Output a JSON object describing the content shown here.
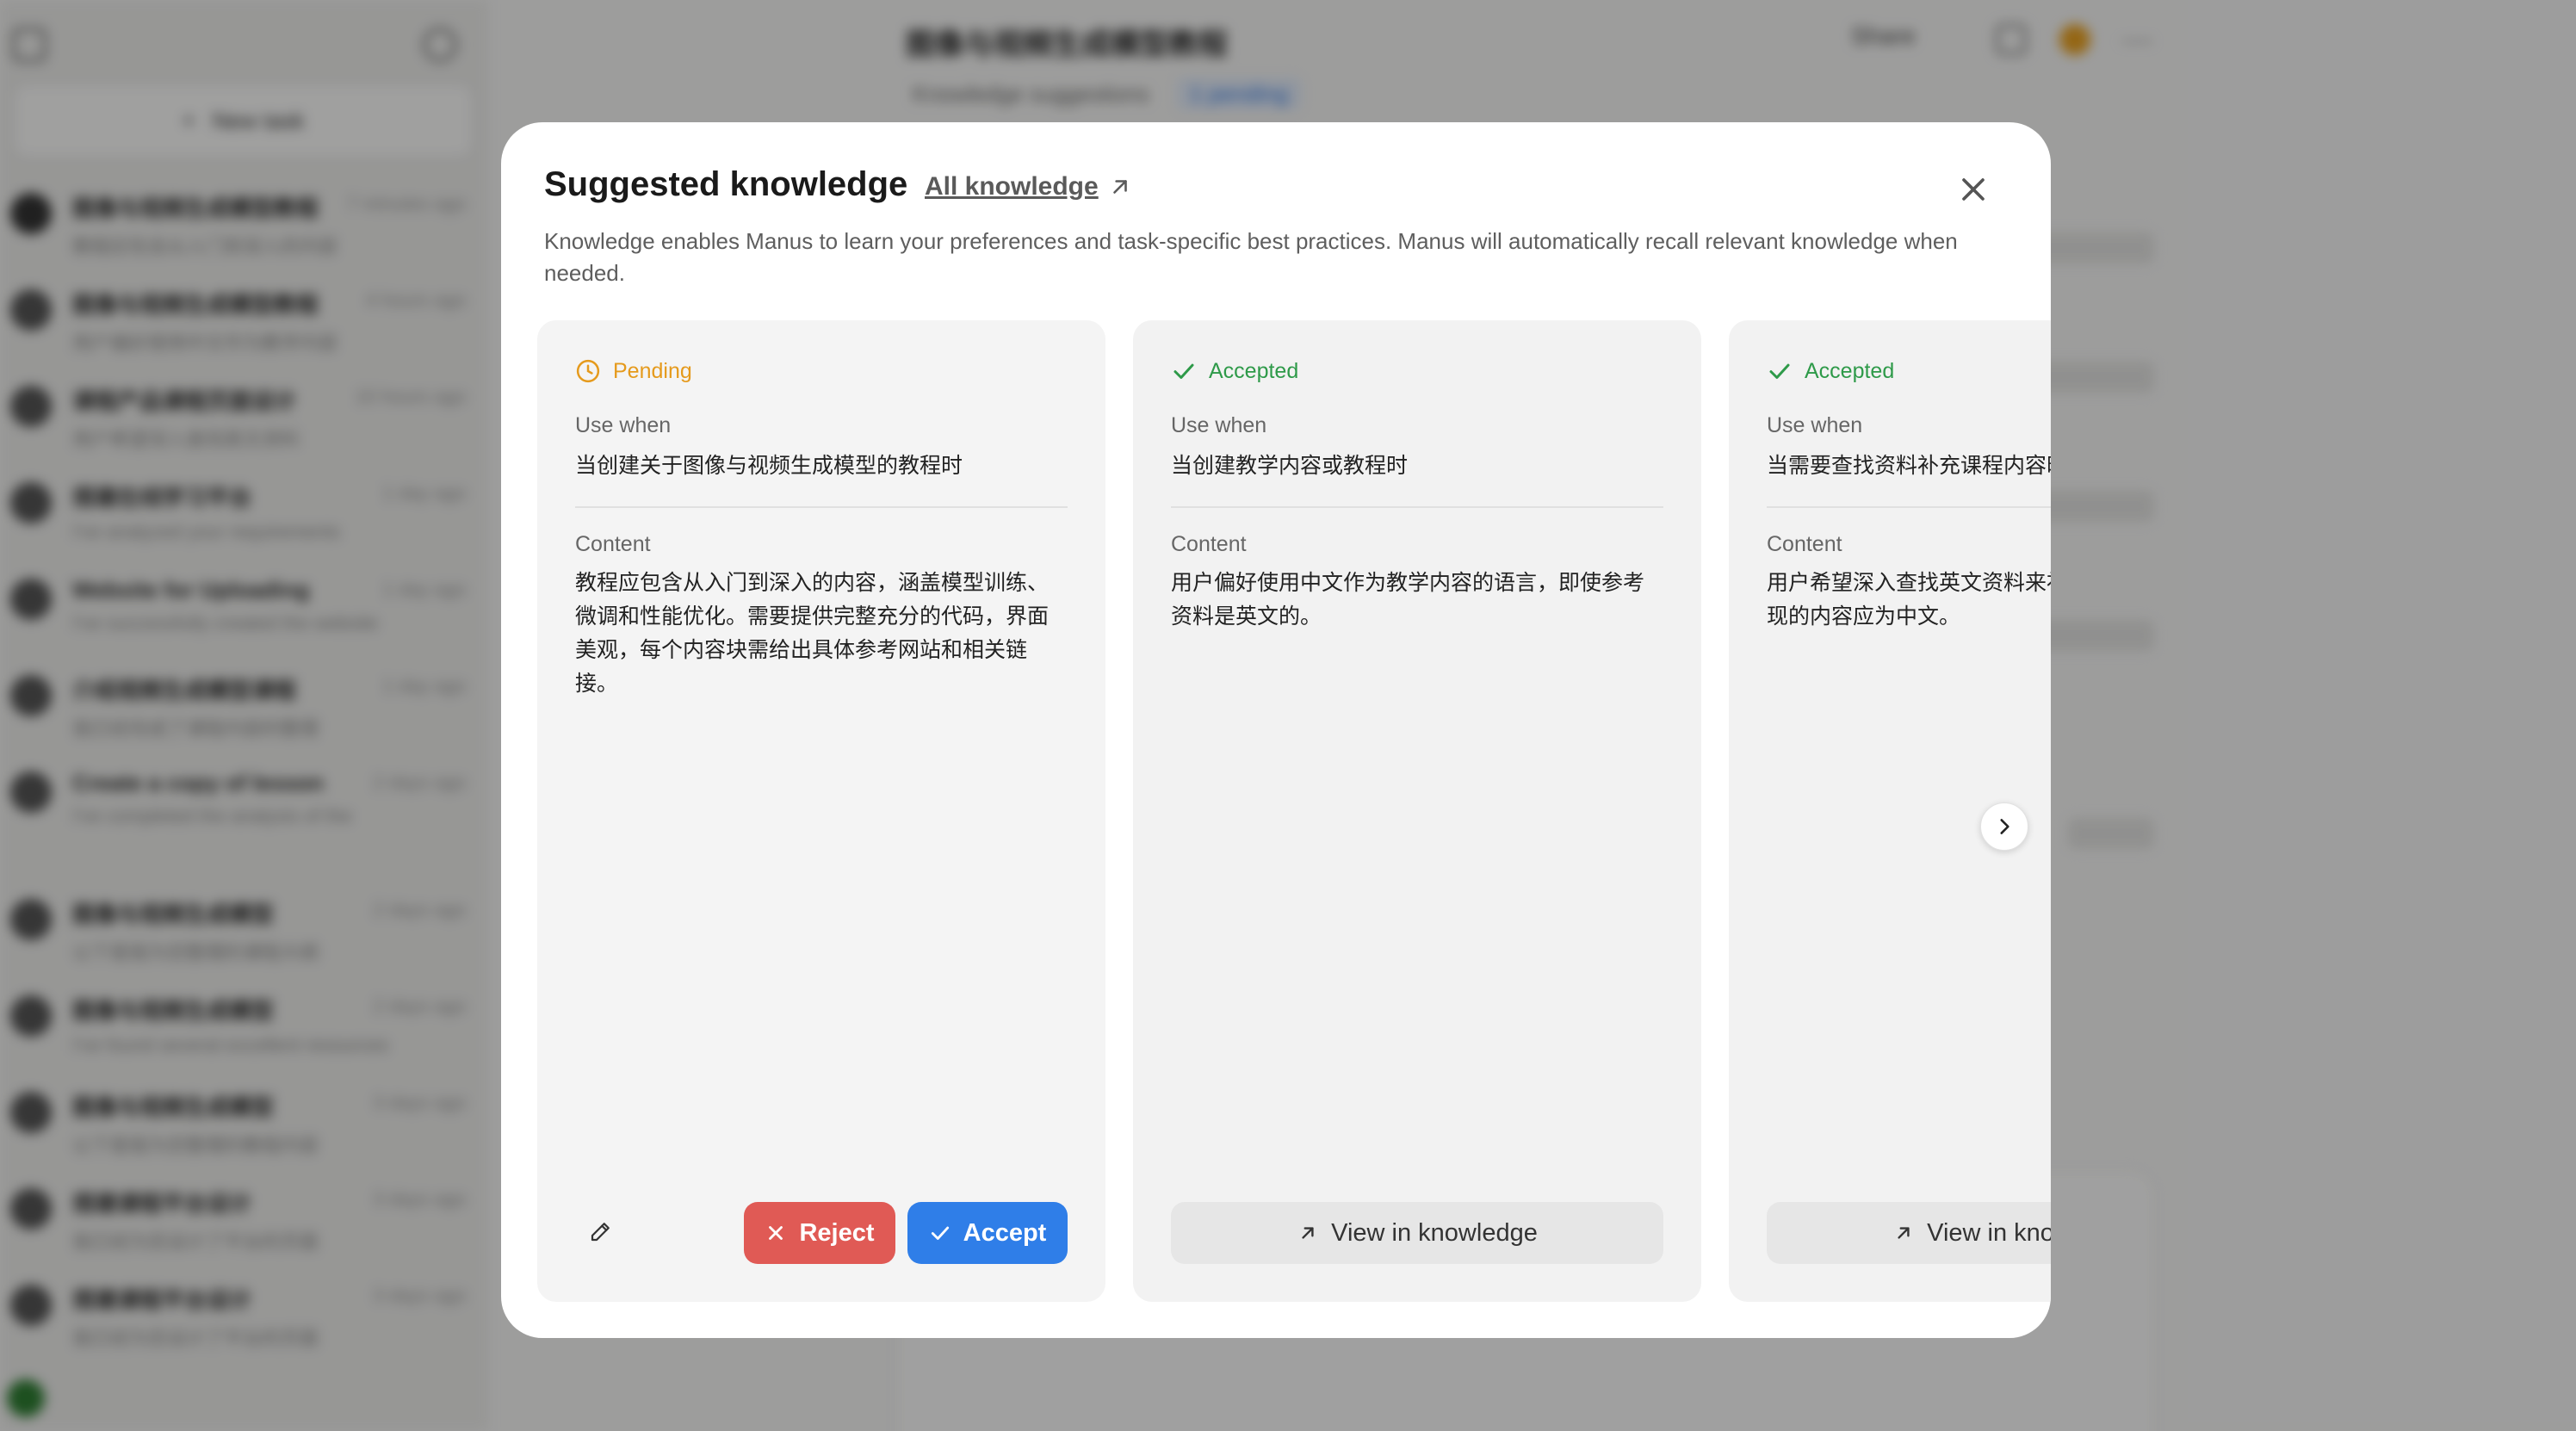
{
  "background": {
    "sidebar": {
      "new_task_label": "New task",
      "tasks": [
        {
          "title": "图像与视频生成模型教程",
          "preview": "教程应包含从入门到深入的内容",
          "time": "7 minutes ago"
        },
        {
          "title": "图像与视频生成模型教程",
          "preview": "用户偏好使用中文作为教学内容",
          "time": "4 hours ago"
        },
        {
          "title": "课程产品课程页面设计",
          "preview": "用户希望深入查找英文资料",
          "time": "10 hours ago"
        },
        {
          "title": "搭建在线学习平台",
          "preview": "I've analyzed your requirements",
          "time": "1 day ago"
        },
        {
          "title": "Website for Uploading",
          "preview": "I've successfully created the website",
          "time": "1 day ago"
        },
        {
          "title": "介绍视频生成模型课程",
          "preview": "我已经完成了课程内容的整理",
          "time": "1 day ago"
        },
        {
          "title": "Create a copy of lesson",
          "preview": "I've completed the analysis of the",
          "time": "2 days ago"
        },
        {
          "title": "图像与视频生成模型",
          "preview": "以下是我为您整理的课程大纲",
          "time": "2 days ago"
        },
        {
          "title": "图像与视频生成模型",
          "preview": "I've found several excellent resources",
          "time": "2 days ago"
        },
        {
          "title": "图像与视频生成模型",
          "preview": "以下是我为您整理的教程内容",
          "time": "3 days ago"
        },
        {
          "title": "搭建课程平台设计",
          "preview": "我已经为您设计了平台的页面",
          "time": "3 days ago"
        },
        {
          "title": "搭建课程平台设计",
          "preview": "我已经为您设计了平台的页面",
          "time": "3 days ago"
        }
      ]
    },
    "main": {
      "title": "图像与视频生成模型教程",
      "subtitle": "Knowledge suggestions",
      "chip": "1 pending",
      "share": "Share"
    }
  },
  "modal": {
    "title": "Suggested knowledge",
    "all_link": "All knowledge",
    "description": "Knowledge enables Manus to learn your preferences and task-specific best practices. Manus will automatically recall relevant knowledge when needed.",
    "use_when_label": "Use when",
    "content_label": "Content",
    "cards": [
      {
        "status": "Pending",
        "use_when": "当创建关于图像与视频生成模型的教程时",
        "content": "教程应包含从入门到深入的内容，涵盖模型训练、微调和性能优化。需要提供完整充分的代码，界面美观，每个内容块需给出具体参考网站和相关链接。",
        "reject_label": "Reject",
        "accept_label": "Accept"
      },
      {
        "status": "Accepted",
        "use_when": "当创建教学内容或教程时",
        "content": "用户偏好使用中文作为教学内容的语言，即使参考资料是英文的。",
        "view_label": "View in knowledge"
      },
      {
        "status": "Accepted",
        "use_when": "当需要查找资料补充课程内容时",
        "content": "用户希望深入查找英文资料来补充课程，但最终呈现的内容应为中文。",
        "view_label": "View in knowledge"
      }
    ]
  },
  "colors": {
    "pending": "#e59a1c",
    "accepted": "#2e9a49",
    "reject": "#e05a55",
    "accept": "#2f7ee8"
  }
}
